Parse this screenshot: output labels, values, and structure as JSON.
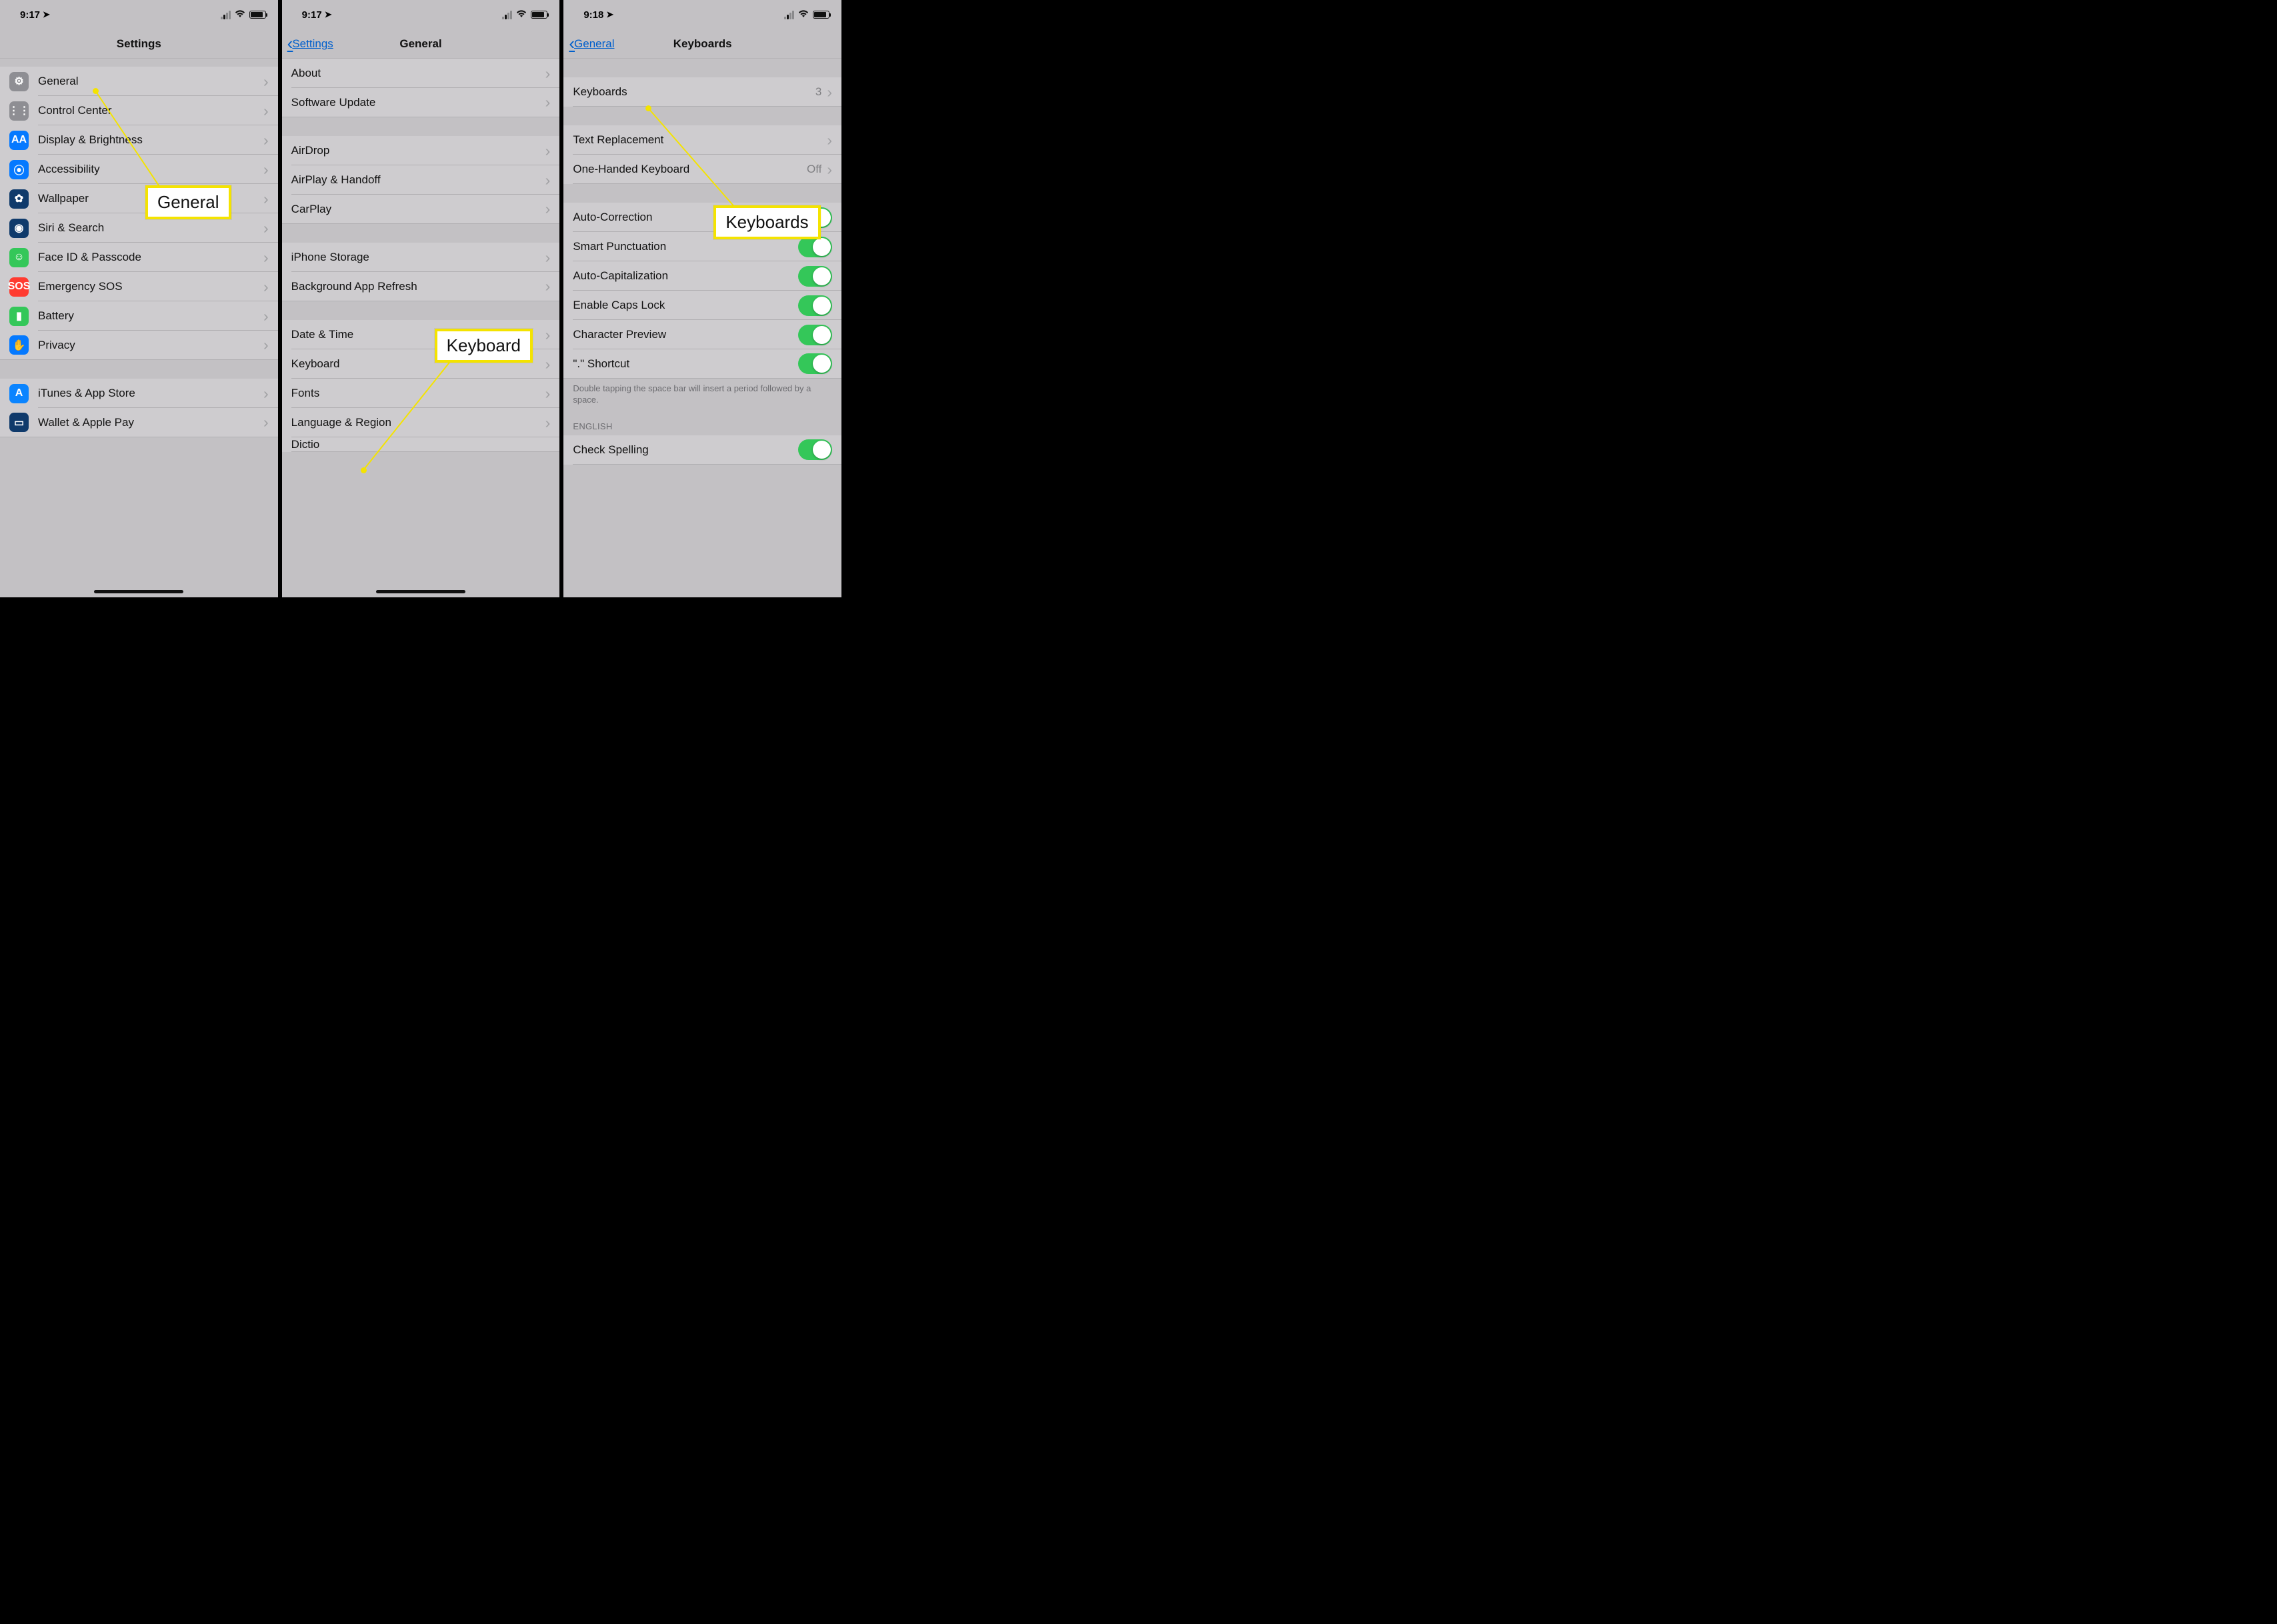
{
  "status": {
    "time1": "9:17",
    "time2": "9:17",
    "time3": "9:18"
  },
  "screen1": {
    "title": "Settings",
    "rows_a": [
      {
        "label": "General",
        "icon": "gear",
        "bg": "bg-gear"
      },
      {
        "label": "Control Center",
        "icon": "sliders",
        "bg": "bg-gear"
      },
      {
        "label": "Display & Brightness",
        "icon": "AA",
        "bg": "bg-blue"
      },
      {
        "label": "Accessibility",
        "icon": "person",
        "bg": "bg-blue"
      },
      {
        "label": "Wallpaper",
        "icon": "flower",
        "bg": "bg-navy"
      },
      {
        "label": "Siri & Search",
        "icon": "siri",
        "bg": "bg-navy"
      },
      {
        "label": "Face ID & Passcode",
        "icon": "face",
        "bg": "bg-green"
      },
      {
        "label": "Emergency SOS",
        "icon": "SOS",
        "bg": "bg-red"
      },
      {
        "label": "Battery",
        "icon": "battery",
        "bg": "bg-green"
      },
      {
        "label": "Privacy",
        "icon": "hand",
        "bg": "bg-blue"
      }
    ],
    "rows_b": [
      {
        "label": "iTunes & App Store",
        "icon": "A",
        "bg": "bg-app"
      },
      {
        "label": "Wallet & Apple Pay",
        "icon": "wallet",
        "bg": "bg-navy"
      }
    ]
  },
  "screen2": {
    "back": "Settings",
    "title": "General",
    "g1": [
      "About",
      "Software Update"
    ],
    "g2": [
      "AirDrop",
      "AirPlay & Handoff",
      "CarPlay"
    ],
    "g3": [
      "iPhone Storage",
      "Background App Refresh"
    ],
    "g4": [
      "Date & Time",
      "Keyboard",
      "Fonts",
      "Language & Region"
    ],
    "cut": "Dictio"
  },
  "screen3": {
    "back": "General",
    "title": "Keyboards",
    "row_kb": {
      "label": "Keyboards",
      "value": "3"
    },
    "g2": [
      "Text Replacement"
    ],
    "ohk": {
      "label": "One-Handed Keyboard",
      "value": "Off"
    },
    "toggles": [
      "Auto-Correction",
      "Smart Punctuation",
      "Auto-Capitalization",
      "Enable Caps Lock",
      "Character Preview",
      "\".\" Shortcut"
    ],
    "footer": "Double tapping the space bar will insert a period followed by a space.",
    "sect": "ENGLISH",
    "last": "Check Spelling"
  },
  "callouts": {
    "c1": "General",
    "c2": "Keyboard",
    "c3": "Keyboards"
  }
}
